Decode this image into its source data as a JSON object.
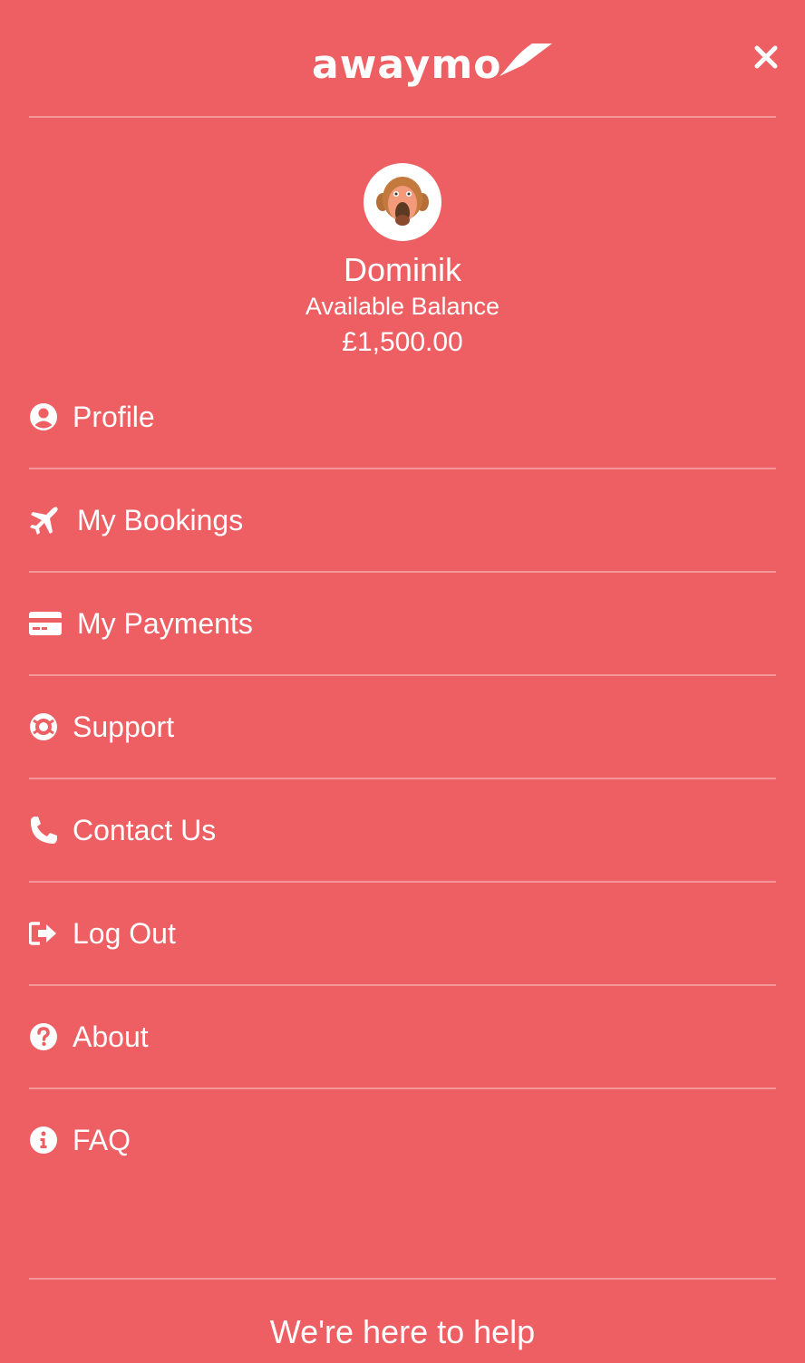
{
  "header": {
    "logo_text": "awaymo",
    "close_icon": "close-icon"
  },
  "user": {
    "name": "Dominik",
    "balance_label": "Available Balance",
    "balance_value": "£1,500.00",
    "avatar": "monkey-avatar"
  },
  "menu": {
    "items": [
      {
        "label": "Profile",
        "icon": "user-circle-icon"
      },
      {
        "label": "My Bookings",
        "icon": "plane-icon"
      },
      {
        "label": "My Payments",
        "icon": "credit-card-icon"
      },
      {
        "label": "Support",
        "icon": "life-ring-icon"
      },
      {
        "label": "Contact Us",
        "icon": "phone-icon"
      },
      {
        "label": "Log Out",
        "icon": "sign-out-icon"
      },
      {
        "label": "About",
        "icon": "question-circle-icon"
      },
      {
        "label": "FAQ",
        "icon": "info-circle-icon"
      }
    ]
  },
  "footer": {
    "text": "We're here to help"
  },
  "colors": {
    "background": "#ED5F63",
    "text": "#FFFFFF"
  }
}
